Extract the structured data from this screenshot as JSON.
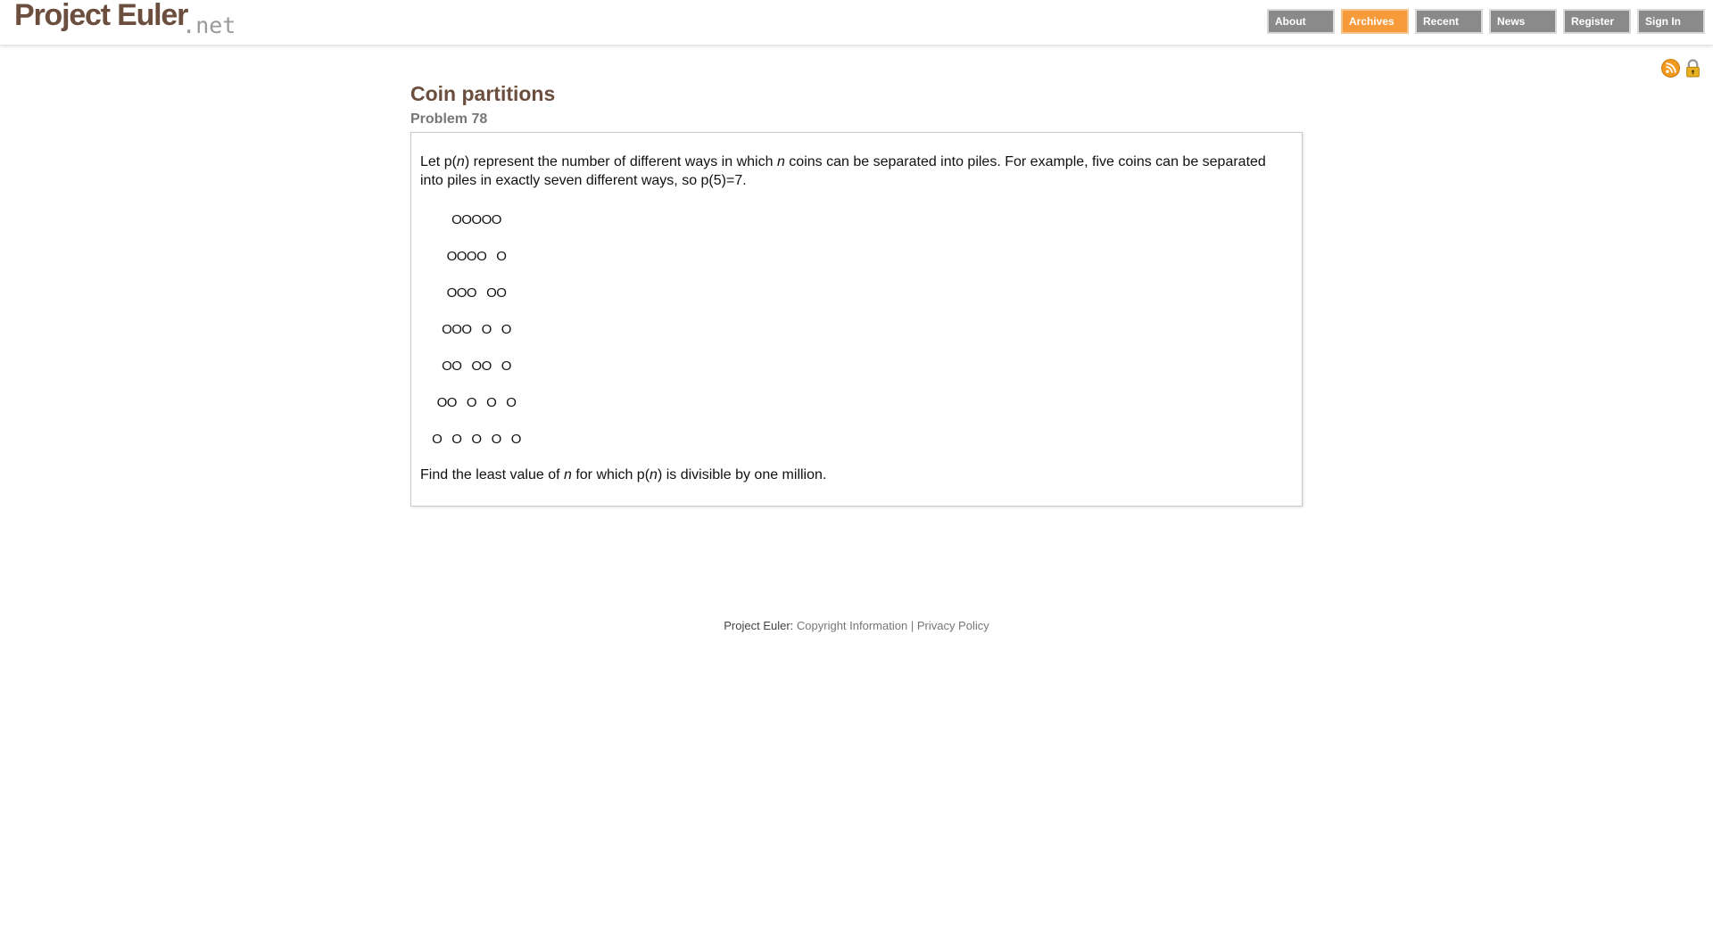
{
  "header": {
    "logo_main": "Project Euler",
    "logo_suffix": ".net",
    "nav": [
      "About",
      "Archives",
      "Recent",
      "News",
      "Register",
      "Sign In"
    ],
    "active_nav": "Archives",
    "icons": [
      "rss-icon",
      "lock-icon"
    ]
  },
  "problem": {
    "title": "Coin partitions",
    "number": "Problem 78",
    "intro_1": "Let p(",
    "intro_var_1": "n",
    "intro_2": ") represent the number of different ways in which ",
    "intro_var_2": "n",
    "intro_3": " coins can be separated into piles. For example, five coins can be separated into piles in exactly seven different ways, so p(5)=7.",
    "partitions": [
      "OOOOO",
      "OOOO   O",
      "OOO   OO",
      "OOO   O   O",
      "OO   OO   O",
      "OO   O   O   O",
      "O   O   O   O   O"
    ],
    "closing_1": "Find the least value of ",
    "closing_var_1": "n",
    "closing_2": " for which p(",
    "closing_var_2": "n",
    "closing_3": ") is divisible by one million."
  },
  "footer": {
    "prefix": "Project Euler: ",
    "copyright_link": "Copyright Information",
    "separator": "|",
    "privacy_link": "Privacy Policy"
  },
  "colors": {
    "brand_brown": "#6b4e3d",
    "nav_gray": "#8a8a8a",
    "nav_active": "#f79a3a",
    "rss_orange": "#f29a1e",
    "lock_gold": "#e8b11f"
  }
}
